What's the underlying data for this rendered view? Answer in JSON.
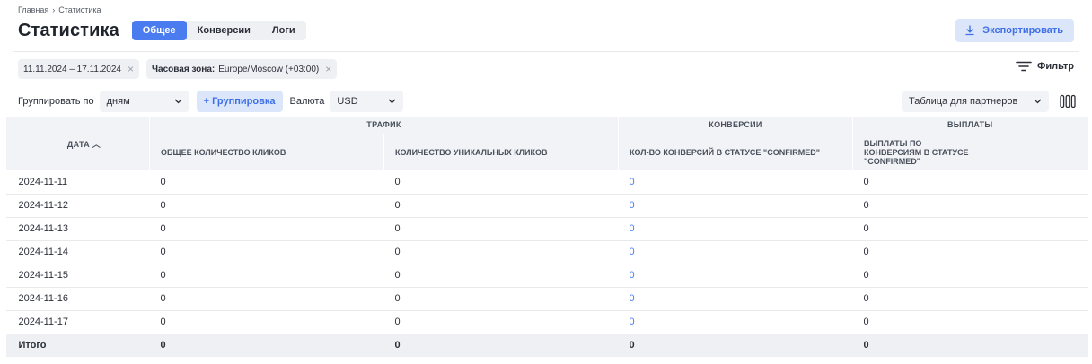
{
  "breadcrumb": {
    "home": "Главная",
    "separator": "›",
    "current": "Статистика"
  },
  "header": {
    "title": "Статистика",
    "tabs": [
      {
        "label": "Общее",
        "active": true
      },
      {
        "label": "Конверсии",
        "active": false
      },
      {
        "label": "Логи",
        "active": false
      }
    ],
    "export_label": "Экспортировать"
  },
  "filters": {
    "date_range": "11.11.2024 – 17.11.2024",
    "timezone_label": "Часовая зона:",
    "timezone_value": "Europe/Moscow (+03:00)",
    "clear_glyph": "×",
    "filter_label": "Фильтр"
  },
  "toolbar": {
    "group_by_label": "Группировать по",
    "group_by_value": "дням",
    "add_group_label": "+ Группировка",
    "currency_label": "Валюта",
    "currency_value": "USD",
    "partner_table_value": "Таблица для партнеров"
  },
  "table": {
    "date_header": "ДАТА",
    "sort_glyph": "︿",
    "groups": [
      "ТРАФИК",
      "КОНВЕРСИИ",
      "ВЫПЛАТЫ"
    ],
    "columns": [
      "ОБЩЕЕ КОЛИЧЕСТВО КЛИКОВ",
      "КОЛИЧЕСТВО УНИКАЛЬНЫХ КЛИКОВ",
      "КОЛ-ВО КОНВЕРСИЙ В СТАТУСЕ \"CONFIRMED\"",
      "ВЫПЛАТЫ ПО КОНВЕРСИЯМ В СТАТУСЕ \"CONFIRMED\""
    ],
    "rows": [
      {
        "date": "2024-11-11",
        "clicks": "0",
        "unique": "0",
        "conversions": "0",
        "payouts": "0"
      },
      {
        "date": "2024-11-12",
        "clicks": "0",
        "unique": "0",
        "conversions": "0",
        "payouts": "0"
      },
      {
        "date": "2024-11-13",
        "clicks": "0",
        "unique": "0",
        "conversions": "0",
        "payouts": "0"
      },
      {
        "date": "2024-11-14",
        "clicks": "0",
        "unique": "0",
        "conversions": "0",
        "payouts": "0"
      },
      {
        "date": "2024-11-15",
        "clicks": "0",
        "unique": "0",
        "conversions": "0",
        "payouts": "0"
      },
      {
        "date": "2024-11-16",
        "clicks": "0",
        "unique": "0",
        "conversions": "0",
        "payouts": "0"
      },
      {
        "date": "2024-11-17",
        "clicks": "0",
        "unique": "0",
        "conversions": "0",
        "payouts": "0"
      }
    ],
    "total": {
      "label": "Итого",
      "clicks": "0",
      "unique": "0",
      "conversions": "0",
      "payouts": "0"
    }
  },
  "colors": {
    "accent": "#4a7cf0",
    "accent_light": "#dce6fb",
    "header_bg": "#f1f3f7"
  },
  "icons": {
    "export": "download-icon",
    "filter": "filter-icon",
    "columns": "columns-icon",
    "chevron": "chevron-down-icon",
    "close": "close-icon"
  }
}
